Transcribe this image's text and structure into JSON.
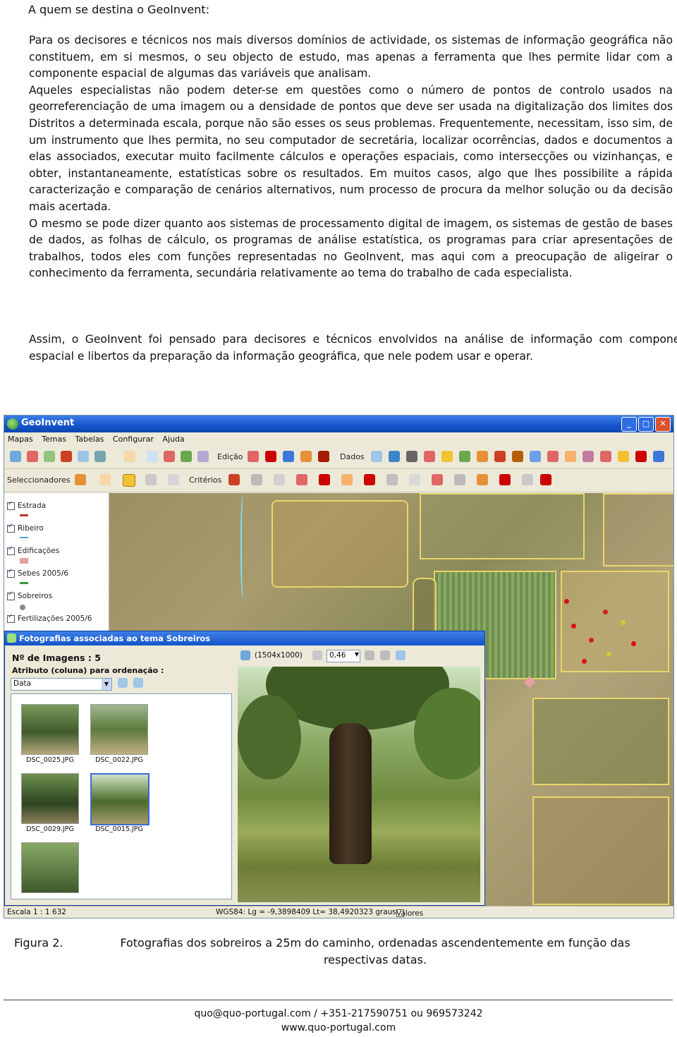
{
  "section_title": "A quem se destina o GeoInvent:",
  "para1_a": "Para os decisores e técnicos nos mais diversos domínios de actividade, os sistemas de informação geográfica não constituem, em si mesmos, o seu objecto de estudo, mas apenas a ferramenta que lhes permite lidar com a componente espacial de algumas das variáveis que analisam.",
  "para1_b": "Aqueles especialistas não podem deter-se em questões como o número de pontos de controlo usados na georreferenciação de uma imagem ou a densidade de pontos que deve ser usada na digitalização dos limites dos Distritos a determinada escala, porque não são esses os seus problemas. Frequentemente, necessitam, isso sim, de um instrumento que lhes permita, no seu computador de secretária, localizar ocorrências, dados e documentos a elas associados, executar muito facilmente cálculos e operações espaciais, como intersecções ou vizinhanças, e obter, instantaneamente, estatísticas sobre os resultados. Em muitos casos, algo que lhes possibilite a rápida caracterização e comparação de cenários alternativos, num processo de procura da melhor solução ou da decisão mais acertada.",
  "para1_c": "O mesmo se pode dizer quanto aos sistemas de processamento digital de imagem, os sistemas de gestão de bases de dados, as folhas de cálculo, os programas de análise estatística, os programas para criar apresentações de trabalhos, todos eles com funções representadas no GeoInvent, mas aqui com a preocupação de aligeirar o conhecimento da ferramenta, secundária relativamente ao tema do trabalho de cada especialista.",
  "para2": "Assim, o GeoInvent foi pensado para decisores e técnicos envolvidos na análise de informação com componente espacial e libertos da preparação da informação geográfica, que nele podem usar e operar.",
  "app": {
    "title": "GeoInvent",
    "window_buttons": [
      "_",
      "□",
      "✕"
    ],
    "menu": [
      "Mapas",
      "Temas",
      "Tabelas",
      "Configurar",
      "Ajuda"
    ],
    "toolbar_labels": {
      "edicao": "Edição",
      "dados": "Dados",
      "seleccionadores": "Seleccionadores",
      "criterios": "Critérios"
    },
    "layers": [
      {
        "label": "Estrada",
        "color": "#c0392b"
      },
      {
        "label": "Ribeiro",
        "color": "#4fa3e0"
      },
      {
        "label": "Edificações",
        "color": "#e8a0a0"
      },
      {
        "label": "Sebes 2005/6",
        "color": "#3a9a3a"
      },
      {
        "label": "Sobreiros",
        "color": "#888888"
      },
      {
        "label": "Fertilizações 2005/6",
        "color": "#555555"
      }
    ],
    "status": {
      "scale": "Escala 1 : 1 632",
      "coords": "WGS84: Lg = -9,3898409 Lt= 38,4920323 graus",
      "local_values": "Valores Locais"
    },
    "photos_window": {
      "title": "Fotografias associadas ao tema Sobreiros",
      "count_label": "Nº de Imagens : 5",
      "attr_label": "Atributo (coluna) para ordenação :",
      "sort_value": "Data",
      "dims": "(1504x1000)",
      "zoom": "0,46",
      "thumbs": [
        "DSC_0025.JPG",
        "DSC_0022.JPG",
        "DSC_0029.JPG",
        "DSC_0015.JPG"
      ]
    }
  },
  "caption_num": "Figura 2.",
  "caption_text": "Fotografias dos sobreiros a 25m do caminho, ordenadas ascendentemente em função das respectivas datas.",
  "contact_line1": "quo@quo-portugal.com / +351-217590751 ou 969573242",
  "contact_line2": "www.quo-portugal.com"
}
